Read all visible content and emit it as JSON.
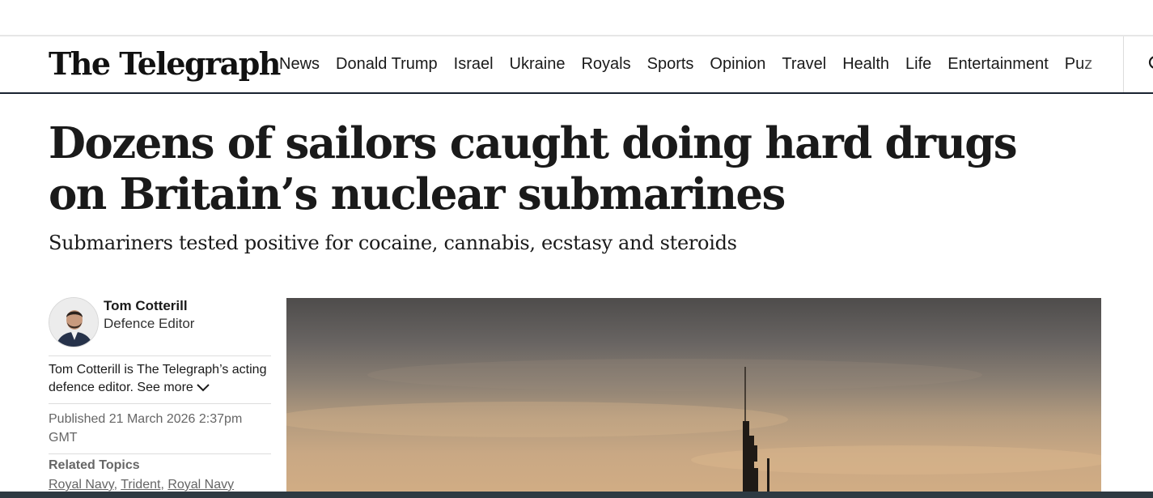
{
  "nav": {
    "logo": "The Telegraph",
    "items": [
      "News",
      "Donald Trump",
      "Israel",
      "Ukraine",
      "Royals",
      "Sports",
      "Opinion",
      "Travel",
      "Health",
      "Life",
      "Entertainment",
      "Puz"
    ]
  },
  "article": {
    "headline": "Dozens of sailors caught doing hard drugs on Britain’s nuclear submarines",
    "standfirst": "Submariners tested positive for cocaine, cannabis, ecstasy and steroids"
  },
  "author": {
    "name": "Tom Cotterill",
    "role": "Defence Editor",
    "bio": "Tom Cotterill is The Telegraph’s acting defence editor.",
    "see_more": "See more"
  },
  "published": "Published 21 March 2026 2:37pm GMT",
  "related": {
    "title": "Related Topics",
    "topics": [
      "Royal Navy",
      "Trident",
      "Royal Navy"
    ]
  }
}
